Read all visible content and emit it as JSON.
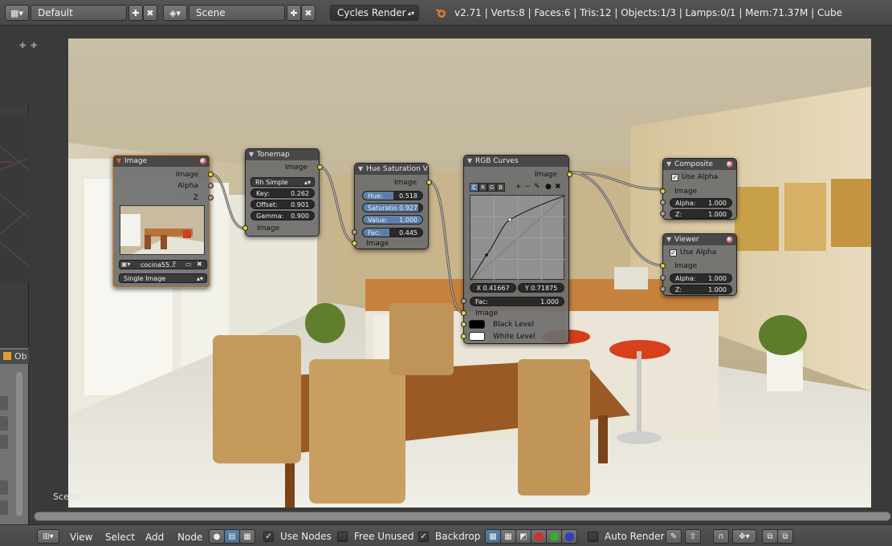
{
  "header": {
    "layout_name": "Default",
    "scene_name": "Scene",
    "render_engine": "Cycles Render",
    "stats": "v2.71 | Verts:8 | Faces:6 | Tris:12 | Objects:1/3 | Lamps:0/1 | Mem:71.37M | Cube"
  },
  "left_panel": {
    "object_tab": "Ob"
  },
  "editor": {
    "scene_label": "Scene"
  },
  "nodes": {
    "image": {
      "title": "Image",
      "out_image": "Image",
      "out_alpha": "Alpha",
      "out_z": "Z",
      "filename": "cocina55...",
      "fake_user": "F",
      "source": "Single Image"
    },
    "tonemap": {
      "title": "Tonemap",
      "out_image": "Image",
      "type": "Rh Simple",
      "key_label": "Key:",
      "key_value": "0.262",
      "offset_label": "Offset:",
      "offset_value": "0.901",
      "gamma_label": "Gamma:",
      "gamma_value": "0.900",
      "in_image": "Image"
    },
    "hsv": {
      "title": "Hue Saturation V...",
      "out_image": "Image",
      "hue_label": "Hue:",
      "hue_value": "0.518",
      "sat_label": "Saturatio",
      "sat_value": "0.927",
      "val_label": "Value:",
      "val_value": "1.000",
      "fac_label": "Fac:",
      "fac_value": "0.445",
      "in_image": "Image"
    },
    "rgb_curves": {
      "title": "RGB Curves",
      "out_image": "Image",
      "tabs": [
        "C",
        "R",
        "G",
        "B"
      ],
      "x_readout": "X 0.41667",
      "y_readout": "Y 0.71875",
      "fac_label": "Fac:",
      "fac_value": "1.000",
      "in_image": "Image",
      "black_level": "Black Level",
      "white_level": "White Level"
    },
    "composite": {
      "title": "Composite",
      "use_alpha": "Use Alpha",
      "in_image": "Image",
      "alpha_label": "Alpha:",
      "alpha_value": "1.000",
      "z_label": "Z:",
      "z_value": "1.000"
    },
    "viewer": {
      "title": "Viewer",
      "use_alpha": "Use Alpha",
      "in_image": "Image",
      "alpha_label": "Alpha:",
      "alpha_value": "1.000",
      "z_label": "Z:",
      "z_value": "1.000"
    }
  },
  "footer": {
    "menu_view": "View",
    "menu_select": "Select",
    "menu_add": "Add",
    "menu_node": "Node",
    "use_nodes": "Use Nodes",
    "free_unused": "Free Unused",
    "backdrop": "Backdrop",
    "auto_render": "Auto Render"
  },
  "colors": {
    "socket_image": "#d8d83a",
    "active_node_border": "#e08b2c",
    "slider_fill": "#5b7fa8"
  }
}
